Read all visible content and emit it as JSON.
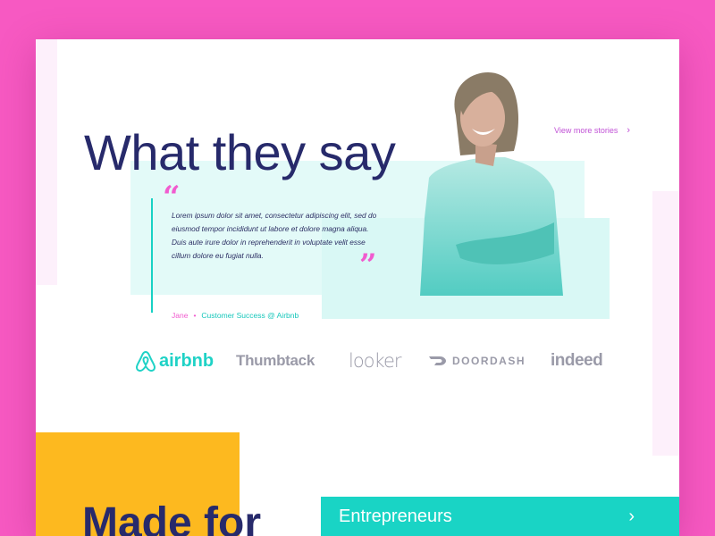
{
  "colors": {
    "background": "#f759c2",
    "heading": "#272a6b",
    "accent_pink": "#f15bcf",
    "accent_teal": "#19d4c5",
    "accent_yellow": "#fdb91f"
  },
  "testimonials": {
    "title": "What they say",
    "view_more_label": "View more stories",
    "view_more_icon": "chevron-right-icon",
    "quote_open": "“",
    "quote_close": "”",
    "quote": "Lorem ipsum dolor sit amet, consectetur adipiscing elit, sed do eiusmod tempor incididunt ut labore et dolore magna aliqua. Duis aute irure dolor in reprehenderit in voluptate velit esse cillum dolore eu fugiat nulla.",
    "author_name": "Jane",
    "separator": "•",
    "author_role": "Customer Success @ Airbnb",
    "photo_icon": "smiling-woman-photo"
  },
  "logos": {
    "airbnb": "airbnb",
    "thumbtack": "Thumbtack",
    "looker": "looker",
    "doordash": "DOORDASH",
    "indeed": "indeed"
  },
  "made_for": {
    "title": "Made for",
    "category_label": "Entrepreneurs",
    "category_icon": "chevron-right-icon"
  }
}
